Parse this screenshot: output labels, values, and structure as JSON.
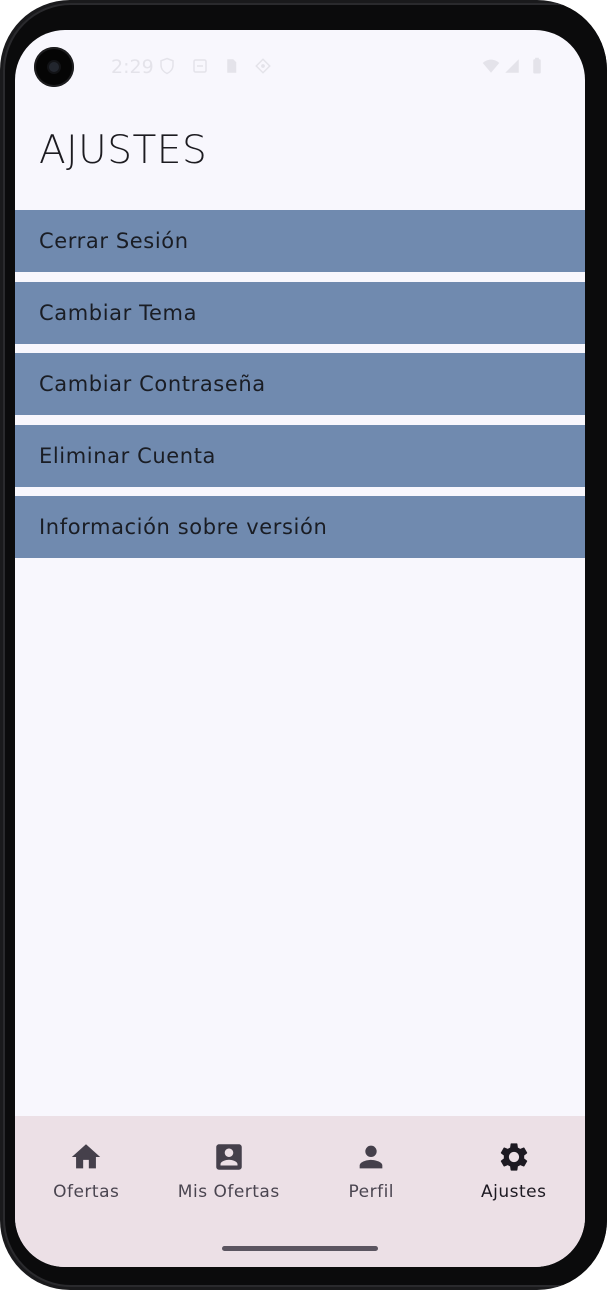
{
  "status_bar": {
    "time": "2:29",
    "left_icons": [
      "shield-icon",
      "screenshot-icon",
      "sim-card-icon",
      "sync-icon"
    ],
    "right_icons": [
      "wifi-icon",
      "signal-icon",
      "battery-icon"
    ]
  },
  "page": {
    "title": "AJUSTES"
  },
  "settings": {
    "items": [
      {
        "label": "Cerrar Sesión"
      },
      {
        "label": "Cambiar Tema"
      },
      {
        "label": "Cambiar Contraseña"
      },
      {
        "label": "Eliminar Cuenta"
      },
      {
        "label": "Información sobre versión"
      }
    ]
  },
  "bottom_nav": {
    "items": [
      {
        "label": "Ofertas",
        "icon": "home-icon",
        "active": false
      },
      {
        "label": "Mis Ofertas",
        "icon": "contact-card-icon",
        "active": false
      },
      {
        "label": "Perfil",
        "icon": "person-icon",
        "active": false
      },
      {
        "label": "Ajustes",
        "icon": "gear-icon",
        "active": true
      }
    ]
  },
  "colors": {
    "screen_background": "#f8f7fd",
    "list_item_background": "#708aaf",
    "bottom_nav_background": "#ece0e6",
    "text_primary": "#1c1b20"
  }
}
